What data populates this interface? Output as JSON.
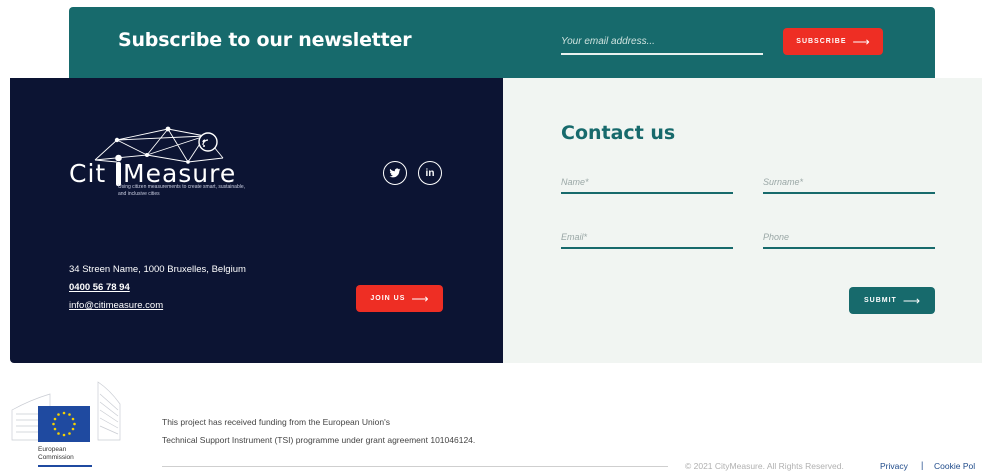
{
  "newsletter": {
    "title": "Subscribe to our newsletter",
    "email_placeholder": "Your email address...",
    "subscribe_label": "SUBSCRIBE",
    "arrow": "⟶"
  },
  "footer": {
    "logo_text": "CitiMeasure",
    "tagline": "Using citizen measurements to create smart, sustainable, and inclusive cities",
    "address": "34 Streen Name, 1000 Bruxelles, Belgium",
    "phone": "0400 56 78 94",
    "email": "info@citimeasure.com",
    "join_label": "JOIN US",
    "social": [
      "twitter-icon",
      "linkedin-icon"
    ],
    "linkedin_text": "in"
  },
  "contact": {
    "title": "Contact us",
    "name_placeholder": "Name*",
    "surname_placeholder": "Surname*",
    "email_placeholder": "Email*",
    "phone_placeholder": "Phone",
    "submit_label": "SUBMIT"
  },
  "bottom": {
    "eu_label_line1": "European",
    "eu_label_line2": "Commission",
    "funding_line1": "This project has received funding from the European Union's",
    "funding_line2": "Technical Support Instrument (TSI) programme under grant agreement 101046124.",
    "copyright": "© 2021 CityMeasure. All Rights Reserved.",
    "privacy": "Privacy",
    "separator": "|",
    "cookie": "Cookie Pol"
  },
  "colors": {
    "teal": "#176a6c",
    "navy": "#0c1433",
    "red": "#ee2e24",
    "mint": "#f1f5f2"
  }
}
